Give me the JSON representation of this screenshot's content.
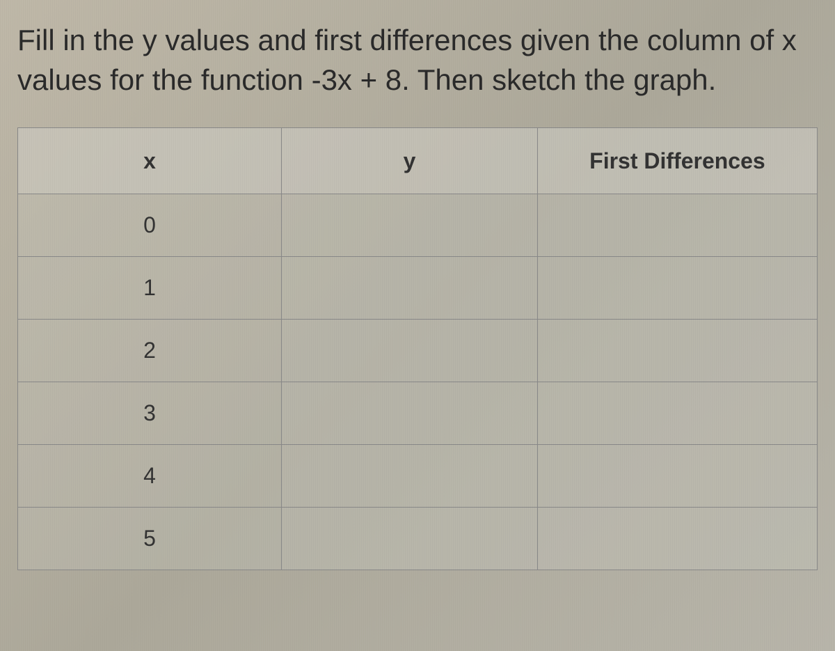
{
  "question": "Fill in the y values and first differences given the column of x values for the function -3x + 8. Then sketch the graph.",
  "table": {
    "headers": {
      "x": "x",
      "y": "y",
      "diff": "First Differences"
    },
    "rows": [
      {
        "x": "0",
        "y": "",
        "diff": ""
      },
      {
        "x": "1",
        "y": "",
        "diff": ""
      },
      {
        "x": "2",
        "y": "",
        "diff": ""
      },
      {
        "x": "3",
        "y": "",
        "diff": ""
      },
      {
        "x": "4",
        "y": "",
        "diff": ""
      },
      {
        "x": "5",
        "y": "",
        "diff": ""
      }
    ]
  }
}
